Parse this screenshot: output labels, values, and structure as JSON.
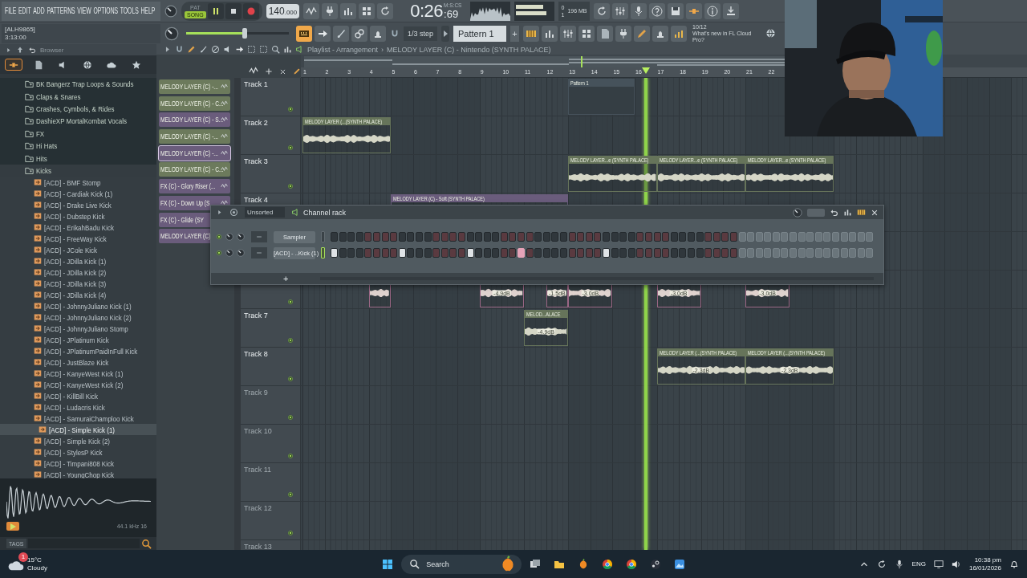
{
  "menu": [
    "FILE",
    "EDIT",
    "ADD",
    "PATTERNS",
    "VIEW",
    "OPTIONS",
    "TOOLS",
    "HELP"
  ],
  "hint": {
    "title": "[ALH9865]",
    "value": "3:13:00"
  },
  "transport": {
    "modes": [
      {
        "label": "PAT",
        "selected": false
      },
      {
        "label": "SONG",
        "selected": true
      }
    ],
    "playing": true,
    "tempo": "140",
    "tempo_fraction": ".000",
    "time_format": "M:S:CS",
    "time": "0:26",
    "time_fraction": ":69"
  },
  "monitor": {
    "counters": [
      "0",
      "1"
    ],
    "memory": "196 MB"
  },
  "master_volume": {
    "level": 0.57
  },
  "mode_buttons": [
    {
      "on": true
    },
    {
      "on": false
    },
    {
      "on": false
    },
    {
      "on": false
    },
    {
      "on": false
    }
  ],
  "snap": "1/3 step",
  "pattern": "Pattern 1",
  "pattern_add": "+",
  "news": {
    "count": "10/12",
    "text": "What's new in FL Cloud Pro?"
  },
  "browser": {
    "title": "Browser",
    "tabs": [
      {
        "selected": true
      },
      {
        "selected": false
      },
      {
        "selected": false
      },
      {
        "selected": false
      },
      {
        "selected": false
      },
      {
        "selected": false
      }
    ],
    "items": [
      {
        "kind": "folder",
        "label": "BK Bangerz Trap Loops & Sounds",
        "expanded": false,
        "selected": false
      },
      {
        "kind": "folder",
        "label": "Claps & Snares",
        "expanded": false,
        "selected": false
      },
      {
        "kind": "folder",
        "label": "Crashes, Cymbols, & Rides",
        "expanded": false,
        "selected": false
      },
      {
        "kind": "folder",
        "label": "DashieXP MortalKombat Vocals",
        "expanded": false,
        "selected": false
      },
      {
        "kind": "folder",
        "label": "FX",
        "expanded": false,
        "selected": false
      },
      {
        "kind": "folder",
        "label": "Hi Hats",
        "expanded": false,
        "selected": false
      },
      {
        "kind": "folder",
        "label": "Hits",
        "expanded": false,
        "selected": false
      },
      {
        "kind": "folder",
        "label": "Kicks",
        "expanded": true,
        "selected": false,
        "children": [
          {
            "kind": "file",
            "label": "[ACD] - BMF Stomp",
            "selected": false
          },
          {
            "kind": "file",
            "label": "[ACD] - Cardiak Kick (1)",
            "selected": false
          },
          {
            "kind": "file",
            "label": "[ACD] - Drake Live Kick",
            "selected": false
          },
          {
            "kind": "file",
            "label": "[ACD] - Dubstep Kick",
            "selected": false
          },
          {
            "kind": "file",
            "label": "[ACD] - ErikahBadu Kick",
            "selected": false
          },
          {
            "kind": "file",
            "label": "[ACD] - FreeWay Kick",
            "selected": false
          },
          {
            "kind": "file",
            "label": "[ACD] - JCole Kick",
            "selected": false
          },
          {
            "kind": "file",
            "label": "[ACD] - JDilla Kick (1)",
            "selected": false
          },
          {
            "kind": "file",
            "label": "[ACD] - JDilla Kick (2)",
            "selected": false
          },
          {
            "kind": "file",
            "label": "[ACD] - JDilla Kick (3)",
            "selected": false
          },
          {
            "kind": "file",
            "label": "[ACD] - JDilla Kick (4)",
            "selected": false
          },
          {
            "kind": "file",
            "label": "[ACD] - JohnnyJuliano Kick (1)",
            "selected": false
          },
          {
            "kind": "file",
            "label": "[ACD] - JohnnyJuliano Kick (2)",
            "selected": false
          },
          {
            "kind": "file",
            "label": "[ACD] - JohnnyJuliano Stomp",
            "selected": false
          },
          {
            "kind": "file",
            "label": "[ACD] - JPlatinum Kick",
            "selected": false
          },
          {
            "kind": "file",
            "label": "[ACD] - JPlatinumPaidInFull Kick",
            "selected": false
          },
          {
            "kind": "file",
            "label": "[ACD] - JustBlaze Kick",
            "selected": false
          },
          {
            "kind": "file",
            "label": "[ACD] - KanyeWest Kick (1)",
            "selected": false
          },
          {
            "kind": "file",
            "label": "[ACD] - KanyeWest Kick (2)",
            "selected": false
          },
          {
            "kind": "file",
            "label": "[ACD] - KillBill Kick",
            "selected": false
          },
          {
            "kind": "file",
            "label": "[ACD] - Ludacris Kick",
            "selected": false
          },
          {
            "kind": "file",
            "label": "[ACD] - SamuraiChamploo Kick",
            "selected": false
          },
          {
            "kind": "file",
            "label": "[ACD] - Simple Kick (1)",
            "selected": true
          },
          {
            "kind": "file",
            "label": "[ACD] - Simple Kick (2)",
            "selected": false
          },
          {
            "kind": "file",
            "label": "[ACD] - StylesP Kick",
            "selected": false
          },
          {
            "kind": "file",
            "label": "[ACD] - Timpani808 Kick",
            "selected": false
          },
          {
            "kind": "file",
            "label": "[ACD] - YoungChop Kick",
            "selected": false
          }
        ]
      }
    ],
    "sample_info": "44.1 kHz 16",
    "tags": "TAGS"
  },
  "playlist": {
    "title": "Playlist - Arrangement",
    "path_separator": "›",
    "path": "MELODY LAYER (C) - Nintendo (SYNTH PALACE)",
    "playhead": {
      "level": 0.475
    },
    "ruler": [
      "1",
      "2",
      "3",
      "4",
      "5",
      "6",
      "7",
      "8",
      "9",
      "10",
      "11",
      "12",
      "13",
      "14",
      "15",
      "16",
      "17",
      "18",
      "19",
      "20",
      "21",
      "22"
    ],
    "channels": [
      {
        "label": "MELODY LAYER (C) -...",
        "color": "#6c7a5c",
        "selected": false
      },
      {
        "label": "MELODY LAYER (C) - C...",
        "color": "#6c7a5c",
        "selected": false
      },
      {
        "label": "MELODY LAYER (C) - S...",
        "color": "#6a5c7c",
        "selected": false
      },
      {
        "label": "MELODY LAYER (C) -...",
        "color": "#6c7a5c",
        "selected": false
      },
      {
        "label": "MELODY LAYER (C) -...",
        "color": "#6a5c7c",
        "selected": true
      },
      {
        "label": "MELODY LAYER (C) - C...",
        "color": "#6c7a5c",
        "selected": false
      },
      {
        "label": "FX (C) - Glory Riser (...",
        "color": "#6a5c7c",
        "selected": false
      },
      {
        "label": "FX (C) - Down Up (S",
        "color": "#6a5c7c",
        "selected": false
      },
      {
        "label": "FX (C) - Glide (SY",
        "color": "#6a5c7c",
        "selected": false
      },
      {
        "label": "MELODY LAYER (C)",
        "color": "#6a5c7c",
        "selected": false
      }
    ],
    "tracks": [
      {
        "kind": "track",
        "name": "Track 1",
        "dimmed": false,
        "lane": [
          {
            "kind": "gap"
          },
          {
            "kind": "gap"
          },
          {
            "kind": "gap"
          },
          {
            "kind": "gap"
          },
          {
            "kind": "gap"
          },
          {
            "kind": "gap"
          },
          {
            "kind": "gap"
          },
          {
            "kind": "gap"
          },
          {
            "kind": "gap"
          },
          {
            "kind": "gap"
          },
          {
            "kind": "gap"
          },
          {
            "kind": "gap"
          },
          {
            "kind": "pattern",
            "label": "Pattern 1",
            "color": "#46525b"
          },
          {
            "kind": "cont"
          },
          {
            "kind": "cont"
          }
        ]
      },
      {
        "kind": "track",
        "name": "Track 2",
        "dimmed": false,
        "lane": [
          {
            "kind": "audio",
            "label": "MELODY LAYER (...(SYNTH PALACE)",
            "color": "#66745a"
          },
          {
            "kind": "cont"
          },
          {
            "kind": "cont"
          },
          {
            "kind": "cont"
          }
        ]
      },
      {
        "kind": "track",
        "name": "Track 3",
        "dimmed": false,
        "lane": [
          {
            "kind": "gap"
          },
          {
            "kind": "gap"
          },
          {
            "kind": "gap"
          },
          {
            "kind": "gap"
          },
          {
            "kind": "gap"
          },
          {
            "kind": "gap"
          },
          {
            "kind": "gap"
          },
          {
            "kind": "gap"
          },
          {
            "kind": "gap"
          },
          {
            "kind": "gap"
          },
          {
            "kind": "gap"
          },
          {
            "kind": "gap"
          },
          {
            "kind": "audio",
            "label": "MELODY LAYER...e (SYNTH PALACE)",
            "color": "#66745a"
          },
          {
            "kind": "cont"
          },
          {
            "kind": "cont"
          },
          {
            "kind": "cont"
          },
          {
            "kind": "audio",
            "label": "MELODY LAYER...e (SYNTH PALACE)",
            "color": "#66745a"
          },
          {
            "kind": "cont"
          },
          {
            "kind": "cont"
          },
          {
            "kind": "cont"
          },
          {
            "kind": "audio",
            "label": "MELODY LAYER...e (SYNTH PALACE)",
            "color": "#66745a"
          },
          {
            "kind": "cont"
          },
          {
            "kind": "cont"
          },
          {
            "kind": "cont"
          }
        ]
      },
      {
        "kind": "track",
        "name": "Track 4",
        "dimmed": false,
        "lane": [
          {
            "kind": "gap"
          },
          {
            "kind": "gap"
          },
          {
            "kind": "gap"
          },
          {
            "kind": "gap"
          },
          {
            "kind": "audio",
            "label": "MELODY LAYER (C) - Soft (SYNTH PALACE)",
            "color": "#6a5c7c"
          },
          {
            "kind": "cont"
          },
          {
            "kind": "cont"
          },
          {
            "kind": "cont"
          },
          {
            "kind": "cont"
          },
          {
            "kind": "cont"
          },
          {
            "kind": "cont"
          },
          {
            "kind": "cont"
          }
        ]
      },
      {
        "kind": "covered"
      },
      {
        "kind": "track",
        "lane": [
          {
            "kind": "gap"
          },
          {
            "kind": "gap"
          },
          {
            "kind": "gap"
          },
          {
            "kind": "audio",
            "color": "#9a6684"
          },
          {
            "kind": "gap"
          },
          {
            "kind": "gap"
          },
          {
            "kind": "gap"
          },
          {
            "kind": "gap"
          },
          {
            "kind": "audio",
            "gain": "-4.9dB",
            "color": "#9a6684"
          },
          {
            "kind": "cont"
          },
          {
            "kind": "gap"
          },
          {
            "kind": "audio",
            "gain": "-1.5dB",
            "color": "#9a6684"
          },
          {
            "kind": "audio",
            "gain": "-3.0dB",
            "color": "#9a6684"
          },
          {
            "kind": "cont"
          },
          {
            "kind": "gap"
          },
          {
            "kind": "gap"
          },
          {
            "kind": "audio",
            "gain": "-3.0dB",
            "color": "#9a6684"
          },
          {
            "kind": "cont"
          },
          {
            "kind": "gap"
          },
          {
            "kind": "gap"
          },
          {
            "kind": "audio",
            "gain": "-3.0dB",
            "color": "#9a6684"
          },
          {
            "kind": "cont"
          }
        ]
      },
      {
        "kind": "track",
        "name": "Track 7",
        "dimmed": false,
        "lane": [
          {
            "kind": "gap"
          },
          {
            "kind": "gap"
          },
          {
            "kind": "gap"
          },
          {
            "kind": "gap"
          },
          {
            "kind": "gap"
          },
          {
            "kind": "gap"
          },
          {
            "kind": "gap"
          },
          {
            "kind": "gap"
          },
          {
            "kind": "gap"
          },
          {
            "kind": "gap"
          },
          {
            "kind": "audio",
            "label": "MELOD...ALACE",
            "gain": "-4.9dB",
            "color": "#66745a"
          },
          {
            "kind": "cont"
          }
        ]
      },
      {
        "kind": "track",
        "name": "Track 8",
        "dimmed": false,
        "lane": [
          {
            "kind": "gap"
          },
          {
            "kind": "gap"
          },
          {
            "kind": "gap"
          },
          {
            "kind": "gap"
          },
          {
            "kind": "gap"
          },
          {
            "kind": "gap"
          },
          {
            "kind": "gap"
          },
          {
            "kind": "gap"
          },
          {
            "kind": "gap"
          },
          {
            "kind": "gap"
          },
          {
            "kind": "gap"
          },
          {
            "kind": "gap"
          },
          {
            "kind": "gap"
          },
          {
            "kind": "gap"
          },
          {
            "kind": "gap"
          },
          {
            "kind": "gap"
          },
          {
            "kind": "audio",
            "label": "MELODY LAYER (...(SYNTH PALACE)",
            "gain": "-2.3dB",
            "color": "#66745a"
          },
          {
            "kind": "cont"
          },
          {
            "kind": "cont"
          },
          {
            "kind": "cont"
          },
          {
            "kind": "audio",
            "label": "MELODY LAYER (...(SYNTH PALACE)",
            "gain": "-2.3dB",
            "color": "#66745a"
          },
          {
            "kind": "cont"
          },
          {
            "kind": "cont"
          },
          {
            "kind": "cont"
          }
        ]
      },
      {
        "kind": "track",
        "name": "Track 9",
        "dimmed": true
      },
      {
        "kind": "track",
        "name": "Track 10",
        "dimmed": true
      },
      {
        "kind": "track",
        "name": "Track 11",
        "dimmed": true
      },
      {
        "kind": "track",
        "name": "Track 12",
        "dimmed": true
      },
      {
        "kind": "track",
        "name": "Track 13",
        "dimmed": true
      }
    ]
  },
  "channel_rack": {
    "filter": "Unsorted",
    "title": "Channel rack",
    "add": "+",
    "channels": [
      {
        "name": "Sampler",
        "selected": false,
        "steps": [
          {
            "on": false,
            "selected": false,
            "enabled": true
          },
          {
            "on": false,
            "selected": false,
            "enabled": true
          },
          {
            "on": false,
            "selected": false,
            "enabled": true
          },
          {
            "on": false,
            "selected": false,
            "enabled": true
          },
          {
            "on": false,
            "selected": false,
            "enabled": true
          },
          {
            "on": false,
            "selected": false,
            "enabled": true
          },
          {
            "on": false,
            "selected": false,
            "enabled": true
          },
          {
            "on": false,
            "selected": false,
            "enabled": true
          },
          {
            "on": false,
            "selected": false,
            "enabled": true
          },
          {
            "on": false,
            "selected": false,
            "enabled": true
          },
          {
            "on": false,
            "selected": false,
            "enabled": true
          },
          {
            "on": false,
            "selected": false,
            "enabled": true
          },
          {
            "on": false,
            "selected": false,
            "enabled": true
          },
          {
            "on": false,
            "selected": false,
            "enabled": true
          },
          {
            "on": false,
            "selected": false,
            "enabled": true
          },
          {
            "on": false,
            "selected": false,
            "enabled": true
          },
          {
            "on": false,
            "selected": false,
            "enabled": true
          },
          {
            "on": false,
            "selected": false,
            "enabled": true
          },
          {
            "on": false,
            "selected": false,
            "enabled": true
          },
          {
            "on": false,
            "selected": false,
            "enabled": true
          },
          {
            "on": false,
            "selected": false,
            "enabled": true
          },
          {
            "on": false,
            "selected": false,
            "enabled": true
          },
          {
            "on": false,
            "selected": false,
            "enabled": true
          },
          {
            "on": false,
            "selected": false,
            "enabled": true
          },
          {
            "on": false,
            "selected": false,
            "enabled": true
          },
          {
            "on": false,
            "selected": false,
            "enabled": true
          },
          {
            "on": false,
            "selected": false,
            "enabled": true
          },
          {
            "on": false,
            "selected": false,
            "enabled": true
          },
          {
            "on": false,
            "selected": false,
            "enabled": true
          },
          {
            "on": false,
            "selected": false,
            "enabled": true
          },
          {
            "on": false,
            "selected": false,
            "enabled": true
          },
          {
            "on": false,
            "selected": false,
            "enabled": true
          },
          {
            "on": false,
            "selected": false,
            "enabled": true
          },
          {
            "on": false,
            "selected": false,
            "enabled": true
          },
          {
            "on": false,
            "selected": false,
            "enabled": true
          },
          {
            "on": false,
            "selected": false,
            "enabled": true
          },
          {
            "on": false,
            "selected": false,
            "enabled": true
          },
          {
            "on": false,
            "selected": false,
            "enabled": true
          },
          {
            "on": false,
            "selected": false,
            "enabled": true
          },
          {
            "on": false,
            "selected": false,
            "enabled": true
          },
          {
            "on": false,
            "selected": false,
            "enabled": true
          },
          {
            "on": false,
            "selected": false,
            "enabled": true
          },
          {
            "on": false,
            "selected": false,
            "enabled": true
          },
          {
            "on": false,
            "selected": false,
            "enabled": true
          },
          {
            "on": false,
            "selected": false,
            "enabled": true
          },
          {
            "on": false,
            "selected": false,
            "enabled": true
          },
          {
            "on": false,
            "selected": false,
            "enabled": true
          },
          {
            "on": false,
            "selected": false,
            "enabled": true
          },
          {
            "on": false,
            "selected": false,
            "enabled": false
          },
          {
            "on": false,
            "selected": false,
            "enabled": false
          },
          {
            "on": false,
            "selected": false,
            "enabled": false
          },
          {
            "on": false,
            "selected": false,
            "enabled": false
          },
          {
            "on": false,
            "selected": false,
            "enabled": false
          },
          {
            "on": false,
            "selected": false,
            "enabled": false
          },
          {
            "on": false,
            "selected": false,
            "enabled": false
          },
          {
            "on": false,
            "selected": false,
            "enabled": false
          },
          {
            "on": false,
            "selected": false,
            "enabled": false
          },
          {
            "on": false,
            "selected": false,
            "enabled": false
          },
          {
            "on": false,
            "selected": false,
            "enabled": false
          },
          {
            "on": false,
            "selected": false,
            "enabled": false
          },
          {
            "on": false,
            "selected": false,
            "enabled": false
          },
          {
            "on": false,
            "selected": false,
            "enabled": false
          },
          {
            "on": false,
            "selected": false,
            "enabled": false
          },
          {
            "on": false,
            "selected": false,
            "enabled": false
          }
        ]
      },
      {
        "name": "[ACD] - ..Kick (1)",
        "selected": true,
        "steps": [
          {
            "on": true,
            "selected": false,
            "enabled": true
          },
          {
            "on": false,
            "selected": false,
            "enabled": true
          },
          {
            "on": false,
            "selected": false,
            "enabled": true
          },
          {
            "on": false,
            "selected": false,
            "enabled": true
          },
          {
            "on": false,
            "selected": false,
            "enabled": true
          },
          {
            "on": false,
            "selected": false,
            "enabled": true
          },
          {
            "on": false,
            "selected": false,
            "enabled": true
          },
          {
            "on": false,
            "selected": false,
            "enabled": true
          },
          {
            "on": true,
            "selected": false,
            "enabled": true
          },
          {
            "on": false,
            "selected": false,
            "enabled": true
          },
          {
            "on": false,
            "selected": false,
            "enabled": true
          },
          {
            "on": false,
            "selected": false,
            "enabled": true
          },
          {
            "on": false,
            "selected": false,
            "enabled": true
          },
          {
            "on": false,
            "selected": false,
            "enabled": true
          },
          {
            "on": false,
            "selected": false,
            "enabled": true
          },
          {
            "on": false,
            "selected": false,
            "enabled": true
          },
          {
            "on": true,
            "selected": false,
            "enabled": true
          },
          {
            "on": false,
            "selected": false,
            "enabled": true
          },
          {
            "on": false,
            "selected": false,
            "enabled": true
          },
          {
            "on": false,
            "selected": false,
            "enabled": true
          },
          {
            "on": false,
            "selected": false,
            "enabled": true
          },
          {
            "on": false,
            "selected": false,
            "enabled": true
          },
          {
            "on": true,
            "selected": true,
            "enabled": true
          },
          {
            "on": false,
            "selected": false,
            "enabled": true
          },
          {
            "on": false,
            "selected": false,
            "enabled": true
          },
          {
            "on": false,
            "selected": false,
            "enabled": true
          },
          {
            "on": false,
            "selected": false,
            "enabled": true
          },
          {
            "on": false,
            "selected": false,
            "enabled": true
          },
          {
            "on": false,
            "selected": false,
            "enabled": true
          },
          {
            "on": false,
            "selected": false,
            "enabled": true
          },
          {
            "on": false,
            "selected": false,
            "enabled": true
          },
          {
            "on": false,
            "selected": false,
            "enabled": true
          },
          {
            "on": true,
            "selected": false,
            "enabled": true
          },
          {
            "on": false,
            "selected": false,
            "enabled": true
          },
          {
            "on": false,
            "selected": false,
            "enabled": true
          },
          {
            "on": false,
            "selected": false,
            "enabled": true
          },
          {
            "on": false,
            "selected": false,
            "enabled": true
          },
          {
            "on": false,
            "selected": false,
            "enabled": true
          },
          {
            "on": false,
            "selected": false,
            "enabled": true
          },
          {
            "on": false,
            "selected": false,
            "enabled": true
          },
          {
            "on": false,
            "selected": false,
            "enabled": true
          },
          {
            "on": false,
            "selected": false,
            "enabled": true
          },
          {
            "on": false,
            "selected": false,
            "enabled": true
          },
          {
            "on": false,
            "selected": false,
            "enabled": true
          },
          {
            "on": false,
            "selected": false,
            "enabled": true
          },
          {
            "on": false,
            "selected": false,
            "enabled": true
          },
          {
            "on": false,
            "selected": false,
            "enabled": true
          },
          {
            "on": false,
            "selected": false,
            "enabled": true
          },
          {
            "on": false,
            "selected": false,
            "enabled": false
          },
          {
            "on": false,
            "selected": false,
            "enabled": false
          },
          {
            "on": false,
            "selected": false,
            "enabled": false
          },
          {
            "on": false,
            "selected": false,
            "enabled": false
          },
          {
            "on": false,
            "selected": false,
            "enabled": false
          },
          {
            "on": false,
            "selected": false,
            "enabled": false
          },
          {
            "on": false,
            "selected": false,
            "enabled": false
          },
          {
            "on": false,
            "selected": false,
            "enabled": false
          },
          {
            "on": false,
            "selected": false,
            "enabled": false
          },
          {
            "on": false,
            "selected": false,
            "enabled": false
          },
          {
            "on": false,
            "selected": false,
            "enabled": false
          },
          {
            "on": false,
            "selected": false,
            "enabled": false
          },
          {
            "on": false,
            "selected": false,
            "enabled": false
          },
          {
            "on": false,
            "selected": false,
            "enabled": false
          },
          {
            "on": false,
            "selected": false,
            "enabled": false
          },
          {
            "on": false,
            "selected": false,
            "enabled": false
          }
        ]
      }
    ]
  },
  "taskbar": {
    "weather": {
      "badge": "1",
      "temperature": "15°C",
      "condition": "Cloudy"
    },
    "search": "Search",
    "language": "ENG",
    "time": "10:38 pm",
    "date": "16/01/2026"
  }
}
